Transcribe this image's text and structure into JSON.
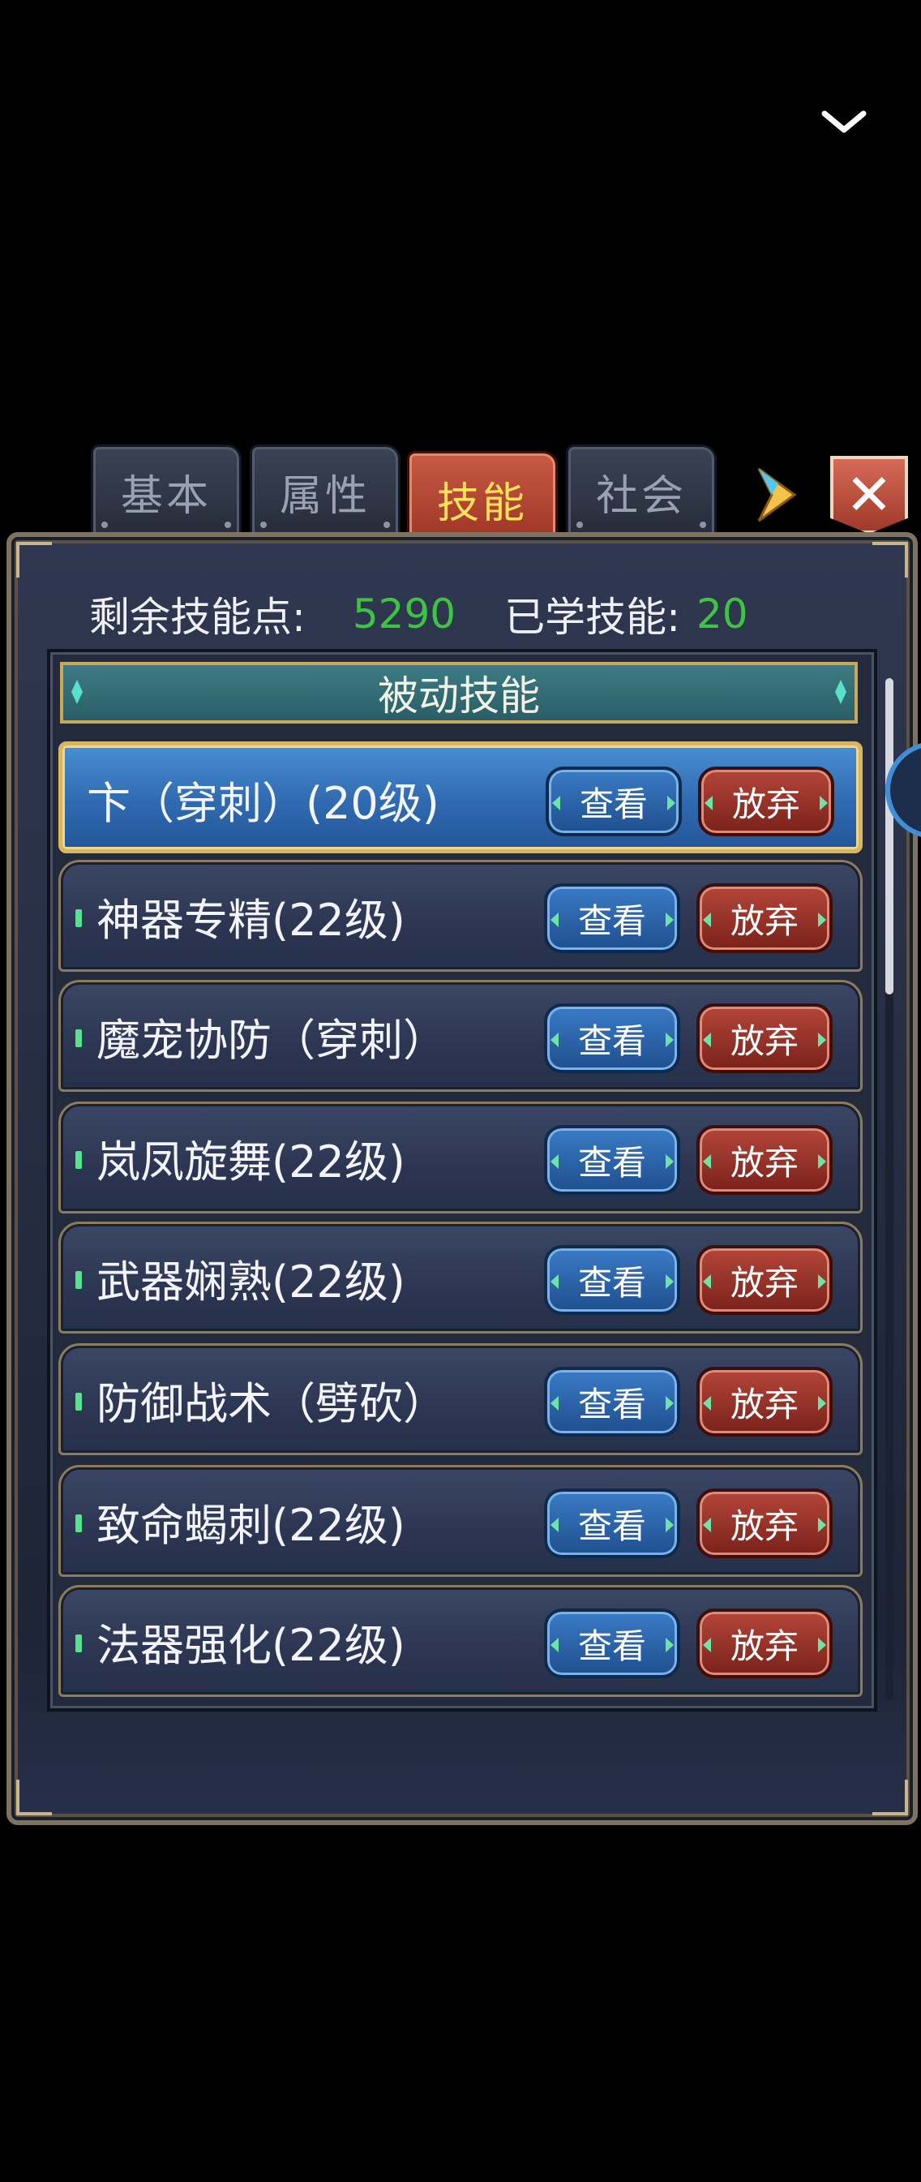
{
  "tabs": [
    {
      "label": "基本",
      "active": false
    },
    {
      "label": "属性",
      "active": false
    },
    {
      "label": "技能",
      "active": true
    },
    {
      "label": "社会",
      "active": false
    }
  ],
  "stats": {
    "remaining_label": "剩余技能点:",
    "remaining_value": "5290",
    "learned_label": "已学技能:",
    "learned_value": "20"
  },
  "section_title": "被动技能",
  "buttons": {
    "view": "查看",
    "drop": "放弃"
  },
  "skills": [
    {
      "name": "卞（穿刺）(20级)",
      "selected": true
    },
    {
      "name": "神器专精(22级)",
      "selected": false
    },
    {
      "name": "魔宠协防（穿刺）",
      "selected": false
    },
    {
      "name": "岚凤旋舞(22级)",
      "selected": false
    },
    {
      "name": "武器娴熟(22级)",
      "selected": false
    },
    {
      "name": "防御战术（劈砍）",
      "selected": false
    },
    {
      "name": "致命蝎刺(22级)",
      "selected": false
    },
    {
      "name": "法器强化(22级)",
      "selected": false
    }
  ],
  "icons": {
    "collapse": "chevron-down-icon",
    "next": "arrow-right-icon",
    "close": "close-icon"
  }
}
